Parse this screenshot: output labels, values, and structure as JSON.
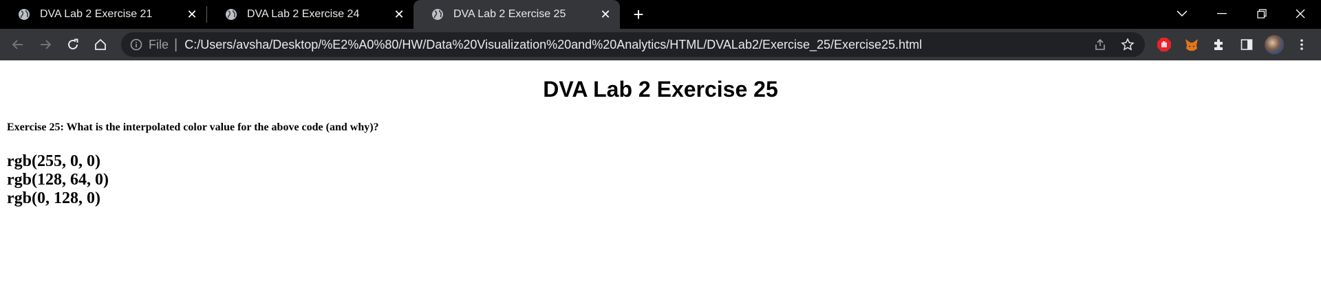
{
  "browser": {
    "tabs": [
      {
        "title": "DVA Lab 2 Exercise 21",
        "active": false
      },
      {
        "title": "DVA Lab 2 Exercise 24",
        "active": false
      },
      {
        "title": "DVA Lab 2 Exercise 25",
        "active": true
      }
    ],
    "address_bar": {
      "scheme_label": "File",
      "url": "C:/Users/avsha/Desktop/%E2%A0%80/HW/Data%20Visualization%20and%20Analytics/HTML/DVALab2/Exercise_25/Exercise25.html"
    },
    "icons": {
      "tab_favicon": "globe-icon",
      "back": "arrow-left-icon",
      "forward": "arrow-right-icon",
      "reload": "reload-icon",
      "home": "home-icon",
      "share": "share-icon",
      "bookmark": "star-icon",
      "extensions": "puzzle-icon",
      "side_panel": "side-panel-icon",
      "menu": "kebab-menu-icon"
    },
    "colors": {
      "tabstrip_bg": "#000000",
      "toolbar_bg": "#35363a",
      "omnibox_bg": "#202124",
      "ext_red": "#e8232a",
      "ext_fox": "#e2761b"
    }
  },
  "page": {
    "title": "DVA Lab 2 Exercise 25",
    "question": "Exercise 25: What is the interpolated color value for the above code (and why)?",
    "answers": [
      "rgb(255, 0, 0)",
      "rgb(128, 64, 0)",
      "rgb(0, 128, 0)"
    ]
  }
}
